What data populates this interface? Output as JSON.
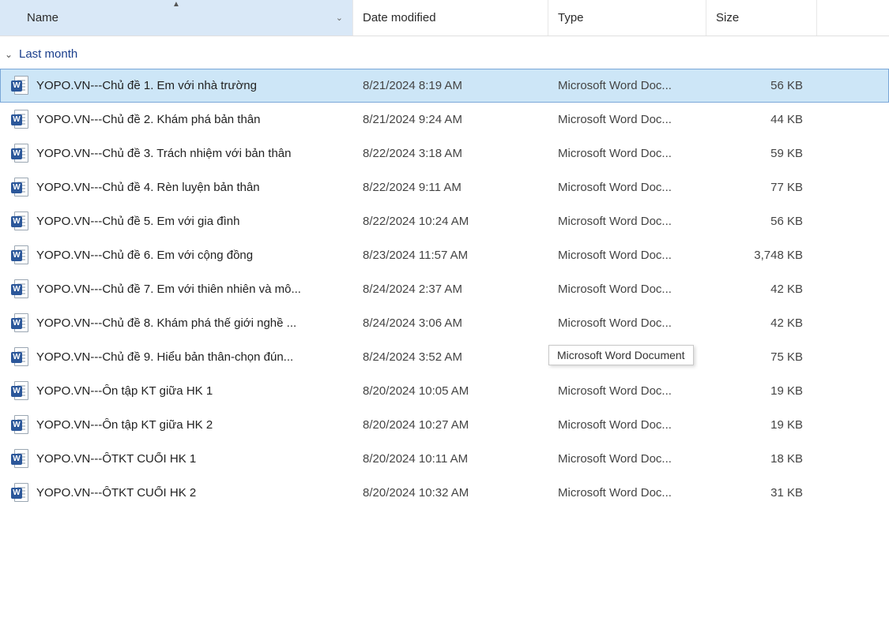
{
  "columns": {
    "name": "Name",
    "date": "Date modified",
    "type": "Type",
    "size": "Size"
  },
  "group_label": "Last month",
  "tooltip_text": "Microsoft Word Document",
  "files": [
    {
      "name": "YOPO.VN---Chủ đề 1. Em với nhà trường",
      "date": "8/21/2024 8:19 AM",
      "type": "Microsoft Word Doc...",
      "size": "56 KB",
      "selected": true
    },
    {
      "name": "YOPO.VN---Chủ đề 2. Khám phá bản thân",
      "date": "8/21/2024 9:24 AM",
      "type": "Microsoft Word Doc...",
      "size": "44 KB",
      "selected": false
    },
    {
      "name": "YOPO.VN---Chủ đề 3. Trách nhiệm với bản thân",
      "date": "8/22/2024 3:18 AM",
      "type": "Microsoft Word Doc...",
      "size": "59 KB",
      "selected": false
    },
    {
      "name": "YOPO.VN---Chủ đề 4. Rèn luyện bản thân",
      "date": "8/22/2024 9:11 AM",
      "type": "Microsoft Word Doc...",
      "size": "77 KB",
      "selected": false
    },
    {
      "name": "YOPO.VN---Chủ đề 5. Em với gia đình",
      "date": "8/22/2024 10:24 AM",
      "type": "Microsoft Word Doc...",
      "size": "56 KB",
      "selected": false
    },
    {
      "name": "YOPO.VN---Chủ đề 6. Em với cộng đồng",
      "date": "8/23/2024 11:57 AM",
      "type": "Microsoft Word Doc...",
      "size": "3,748 KB",
      "selected": false
    },
    {
      "name": "YOPO.VN---Chủ đề 7. Em với thiên nhiên và mô...",
      "date": "8/24/2024 2:37 AM",
      "type": "Microsoft Word Doc...",
      "size": "42 KB",
      "selected": false
    },
    {
      "name": "YOPO.VN---Chủ đề 8. Khám phá thế giới nghề ...",
      "date": "8/24/2024 3:06 AM",
      "type": "Microsoft Word Doc...",
      "size": "42 KB",
      "selected": false
    },
    {
      "name": "YOPO.VN---Chủ đề 9. Hiểu bản thân-chọn đún...",
      "date": "8/24/2024 3:52 AM",
      "type": "Microsoft Word Doc...",
      "size": "75 KB",
      "selected": false,
      "tooltip": true
    },
    {
      "name": "YOPO.VN---Ôn tập KT giữa HK 1",
      "date": "8/20/2024 10:05 AM",
      "type": "Microsoft Word Doc...",
      "size": "19 KB",
      "selected": false
    },
    {
      "name": "YOPO.VN---Ôn tập KT giữa HK 2",
      "date": "8/20/2024 10:27 AM",
      "type": "Microsoft Word Doc...",
      "size": "19 KB",
      "selected": false
    },
    {
      "name": "YOPO.VN---ÔTKT CUỐI HK 1",
      "date": "8/20/2024 10:11 AM",
      "type": "Microsoft Word Doc...",
      "size": "18 KB",
      "selected": false
    },
    {
      "name": "YOPO.VN---ÔTKT CUỐI HK 2",
      "date": "8/20/2024 10:32 AM",
      "type": "Microsoft Word Doc...",
      "size": "31 KB",
      "selected": false
    }
  ]
}
